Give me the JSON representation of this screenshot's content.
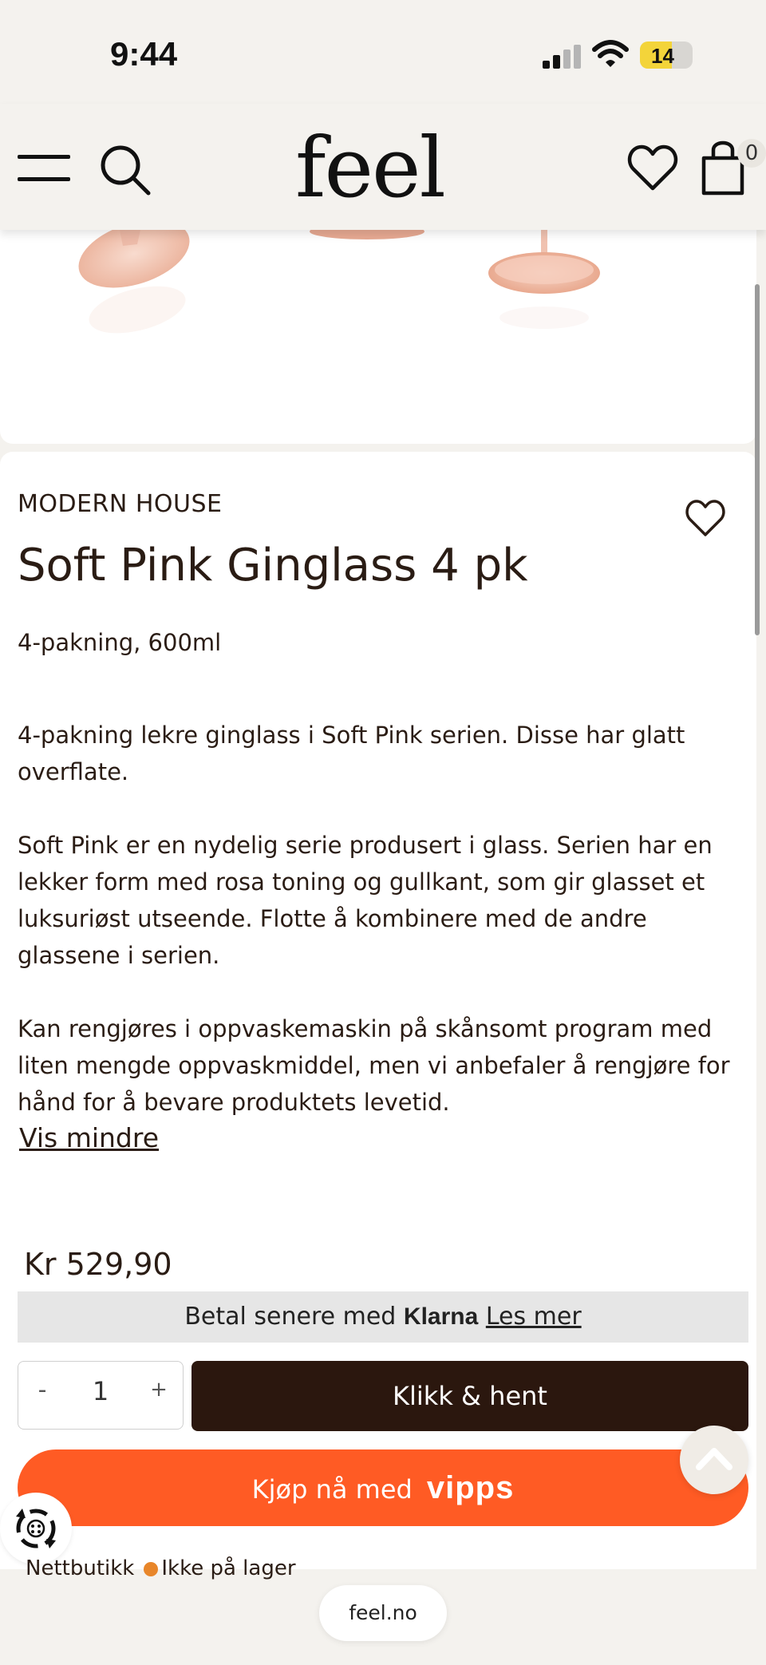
{
  "status_bar": {
    "time": "9:44",
    "battery": "14"
  },
  "header": {
    "logo": "feel",
    "cart_count": "0"
  },
  "product": {
    "brand": "MODERN HOUSE",
    "title": "Soft Pink Ginglass 4 pk",
    "subtitle": "4-pakning, 600ml",
    "description": [
      "4-pakning lekre ginglass i Soft Pink serien. Disse har glatt overflate.",
      "Soft Pink er en nydelig serie produsert i glass. Serien har en lekker form med rosa toning og gullkant, som gir glasset et luksuriøst utseende. Flotte å kombinere med de andre glassene i serien.",
      "Kan rengjøres i oppvaskemaskin på skånsomt program med liten mengde oppvaskmiddel, men vi anbefaler å rengjøre for hånd for å bevare produktets levetid."
    ],
    "toggle_label": "Vis mindre",
    "price": "Kr 529,90"
  },
  "klarna": {
    "prefix": "Betal senere med",
    "brand": "Klarna",
    "link": "Les mer"
  },
  "purchase": {
    "minus": "-",
    "quantity": "1",
    "plus": "+",
    "click_collect": "Klikk & hent",
    "vipps_prefix": "Kjøp nå med",
    "vipps_brand": "vipps"
  },
  "stock": {
    "channel": "Nettbutikk",
    "status": "Ikke på lager",
    "status_color": "#e8862a"
  },
  "browser": {
    "url": "feel.no"
  }
}
